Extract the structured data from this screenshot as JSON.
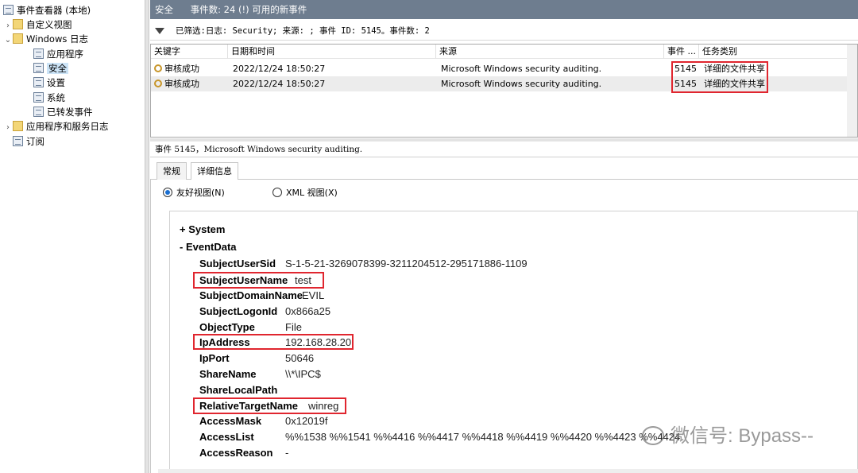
{
  "tree": {
    "root": "事件查看器 (本地)",
    "custom_views": "自定义视图",
    "windows_logs": "Windows 日志",
    "logs": [
      "应用程序",
      "安全",
      "设置",
      "系统",
      "已转发事件"
    ],
    "app_service_logs": "应用程序和服务日志",
    "subscriptions": "订阅"
  },
  "title_bar": {
    "log_name": "安全",
    "count_text": "事件数: 24 (!) 可用的新事件"
  },
  "filter_bar": {
    "text": "已筛选:日志: Security; 来源: ; 事件 ID: 5145。事件数: 2"
  },
  "grid": {
    "columns": [
      "关键字",
      "日期和时间",
      "来源",
      "事件 ...",
      "任务类别"
    ],
    "rows": [
      {
        "keyword": "审核成功",
        "datetime": "2022/12/24 18:50:27",
        "source": "Microsoft Windows security auditing.",
        "event_id": "5145",
        "task": "详细的文件共享"
      },
      {
        "keyword": "审核成功",
        "datetime": "2022/12/24 18:50:27",
        "source": "Microsoft Windows security auditing.",
        "event_id": "5145",
        "task": "详细的文件共享"
      }
    ]
  },
  "event_header": "事件 5145，Microsoft Windows security auditing.",
  "tabs": [
    "常规",
    "详细信息"
  ],
  "view_options": {
    "friendly": "友好视图(N)",
    "xml": "XML 视图(X)",
    "selected": "friendly"
  },
  "sections": {
    "system": "+ System",
    "eventdata": "- EventData"
  },
  "fields": [
    {
      "name": "SubjectUserSid",
      "value": "S-1-5-21-3269078399-3211204512-295171886-1109"
    },
    {
      "name": "SubjectUserName",
      "value": "test"
    },
    {
      "name": "SubjectDomainName",
      "value": "EVIL"
    },
    {
      "name": "SubjectLogonId",
      "value": "0x866a25"
    },
    {
      "name": "ObjectType",
      "value": "File"
    },
    {
      "name": "IpAddress",
      "value": "192.168.28.20"
    },
    {
      "name": "IpPort",
      "value": "50646"
    },
    {
      "name": "ShareName",
      "value": "\\\\*\\IPC$"
    },
    {
      "name": "ShareLocalPath",
      "value": ""
    },
    {
      "name": "RelativeTargetName",
      "value": "winreg"
    },
    {
      "name": "AccessMask",
      "value": "0x12019f"
    },
    {
      "name": "AccessList",
      "value": "%%1538 %%1541 %%4416 %%4417 %%4418 %%4419 %%4420 %%4423 %%4424"
    },
    {
      "name": "AccessReason",
      "value": "-"
    }
  ],
  "watermark": "微信号: Bypass--",
  "colors": {
    "highlight": "#e0262f",
    "title_bar": "#6e7d8f",
    "selection": "#cce4f7"
  }
}
